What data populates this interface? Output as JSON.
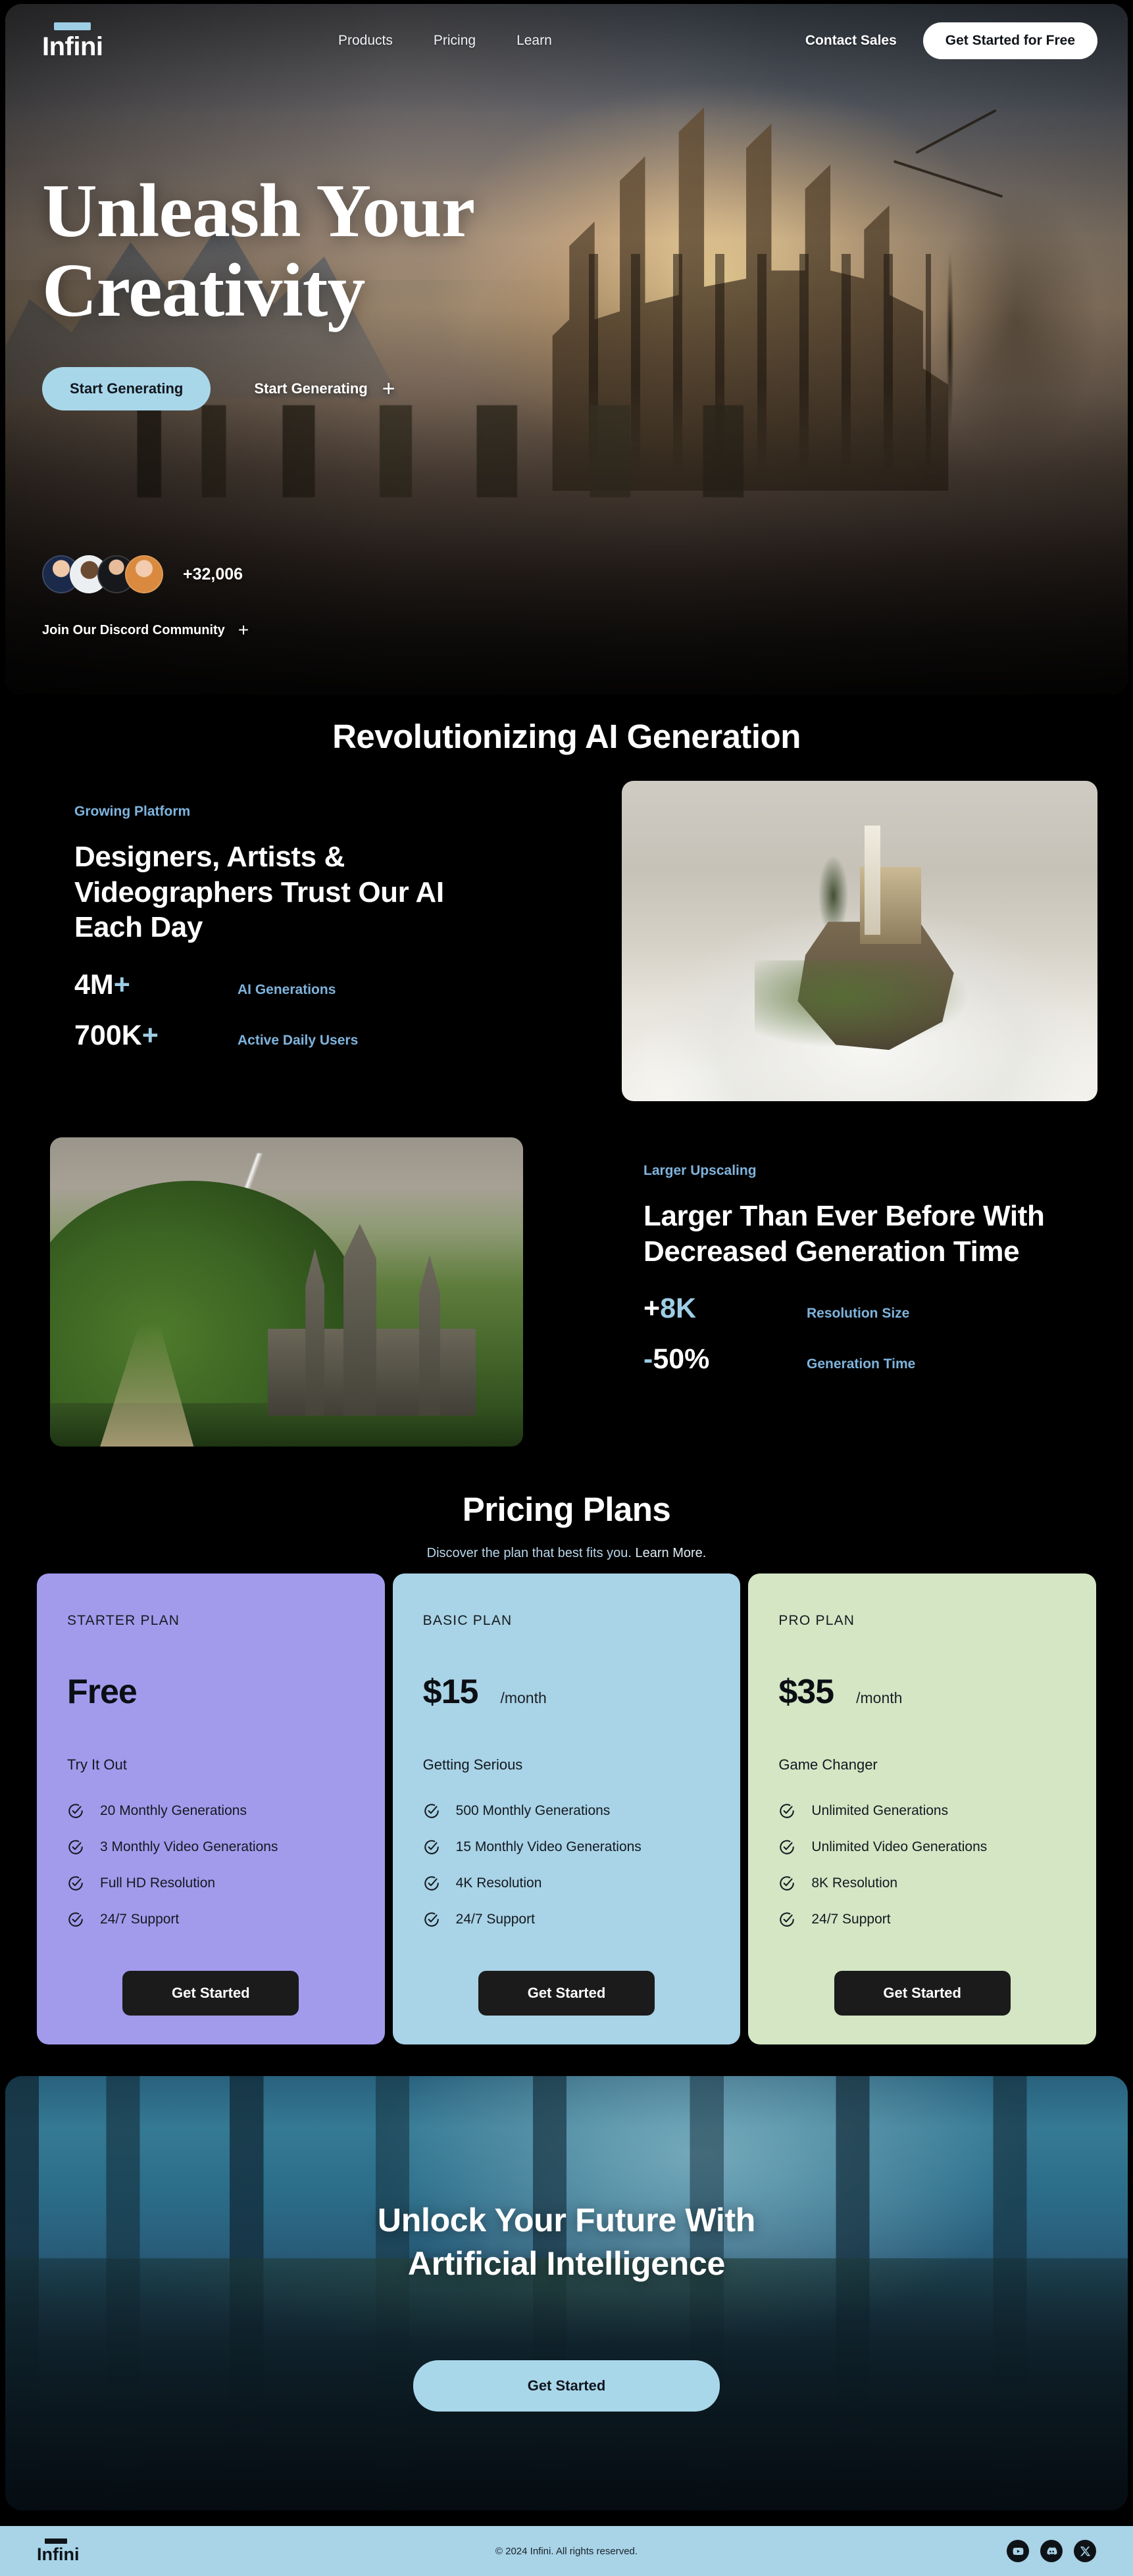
{
  "brand": {
    "name": "Infini"
  },
  "nav": {
    "links": [
      {
        "label": "Products"
      },
      {
        "label": "Pricing"
      },
      {
        "label": "Learn"
      }
    ],
    "contact_label": "Contact Sales",
    "cta_label": "Get Started for Free"
  },
  "hero": {
    "title": "Unleash Your Creativity",
    "primary_cta": "Start Generating",
    "secondary_cta": "Start Generating",
    "secondary_cta_icon": "plus-icon",
    "community_count": "+32,006",
    "community_join_label": "Join Our Discord Community",
    "community_join_icon": "plus-icon",
    "avatar_count": 4
  },
  "revolution": {
    "heading": "Revolutionizing AI Generation",
    "features": [
      {
        "eyebrow": "Growing Platform",
        "title": "Designers, Artists & Videographers Trust Our AI Each Day",
        "image": "castle-in-clouds",
        "stats": [
          {
            "value": "4M",
            "accent": "+",
            "label": "AI Generations"
          },
          {
            "value": "700K",
            "accent": "+",
            "label": "Active Daily Users"
          }
        ]
      },
      {
        "eyebrow": "Larger Upscaling",
        "title": "Larger Than Ever Before With Decreased Generation Time",
        "image": "castle-on-green-hills",
        "stats": [
          {
            "value": "+",
            "accent": "8K",
            "label": "Resolution Size",
            "accent_first": false
          },
          {
            "value": "-",
            "accent": "50%",
            "label": "Generation Time"
          }
        ]
      }
    ]
  },
  "pricing": {
    "heading": "Pricing Plans",
    "subtitle_text": "Discover the plan that best fits you. ",
    "subtitle_link": "Learn More.",
    "plans": [
      {
        "name": "STARTER PLAN",
        "price": "Free",
        "period": "",
        "tagline": "Try It Out",
        "cta_label": "Get Started",
        "color": "#a29bec",
        "features": [
          "20 Monthly Generations",
          "3 Monthly Video Generations",
          "Full HD Resolution",
          "24/7 Support"
        ]
      },
      {
        "name": "BASIC PLAN",
        "price": "$15",
        "period": "/month",
        "tagline": "Getting Serious",
        "cta_label": "Get Started",
        "color": "#a9d3e6",
        "features": [
          "500 Monthly Generations",
          "15 Monthly Video Generations",
          "4K Resolution",
          "24/7 Support"
        ]
      },
      {
        "name": "PRO PLAN",
        "price": "$35",
        "period": "/month",
        "tagline": "Game Changer",
        "cta_label": "Get Started",
        "color": "#d4e6c4",
        "features": [
          "Unlimited Generations",
          "Unlimited Video Generations",
          "8K Resolution",
          "24/7 Support"
        ]
      }
    ]
  },
  "cta_banner": {
    "title_line1": "Unlock Your Future With",
    "title_line2": "Artificial Intelligence",
    "button_label": "Get Started"
  },
  "footer": {
    "logo": "Infini",
    "copyright": "© 2024 Infini. All rights reserved.",
    "socials": [
      {
        "name": "youtube-icon"
      },
      {
        "name": "discord-icon"
      },
      {
        "name": "x-icon"
      }
    ]
  },
  "colors": {
    "accent_blue": "#a9d7ea",
    "link_blue": "#7fb4dd",
    "dark_bg": "#000000",
    "starter": "#a29bec",
    "basic": "#a9d3e6",
    "pro": "#d4e6c4"
  }
}
